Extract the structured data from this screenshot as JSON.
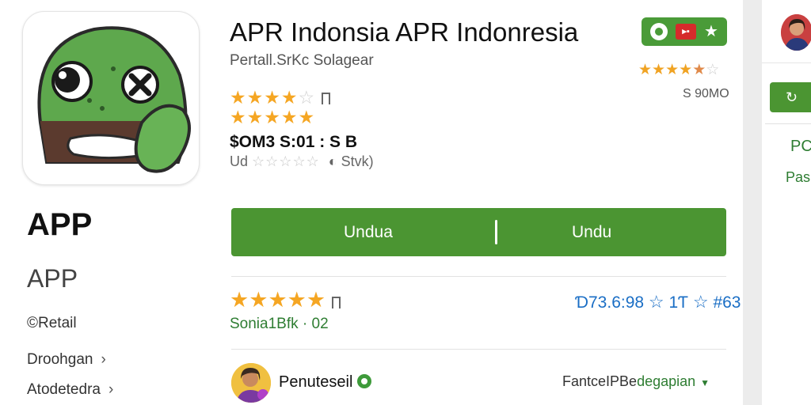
{
  "app": {
    "title": "APR Indonsia APR Indonresia",
    "subtitle": "Pertall.SrKc Solagear",
    "name_large": "APP",
    "name_medium": "APP"
  },
  "header": {
    "rating_stars": 4,
    "second_row_stars": 5,
    "price": "$OM3 S:01 : S B",
    "review_prefix": "Ud",
    "review_tag": "Stvk)",
    "right_rating_stars": 4.5,
    "right_number": "S 90MO"
  },
  "sidebar_links": {
    "detail": "©Retail",
    "link1": "Droohgan",
    "link2": "Atodetedra"
  },
  "download_button": {
    "left_label": "Undua",
    "right_label": "Undu"
  },
  "rating_section": {
    "stars": 5,
    "subtext": "Sonia1Bfk · 02",
    "blue_text_1": "Ɗ73.6:98",
    "blue_text_2": "1Ƭ",
    "blue_text_3": "#63"
  },
  "author": {
    "name": "Penuteseil",
    "right_prefix": "FantceIPBe",
    "right_link": "degapian"
  },
  "side_panel": {
    "button_icon": "refresh-icon",
    "text1": "PC",
    "text2": "Pas"
  },
  "colors": {
    "brand_green": "#4b9532",
    "star_yellow": "#f5a623",
    "link_blue": "#1a6ec5"
  }
}
